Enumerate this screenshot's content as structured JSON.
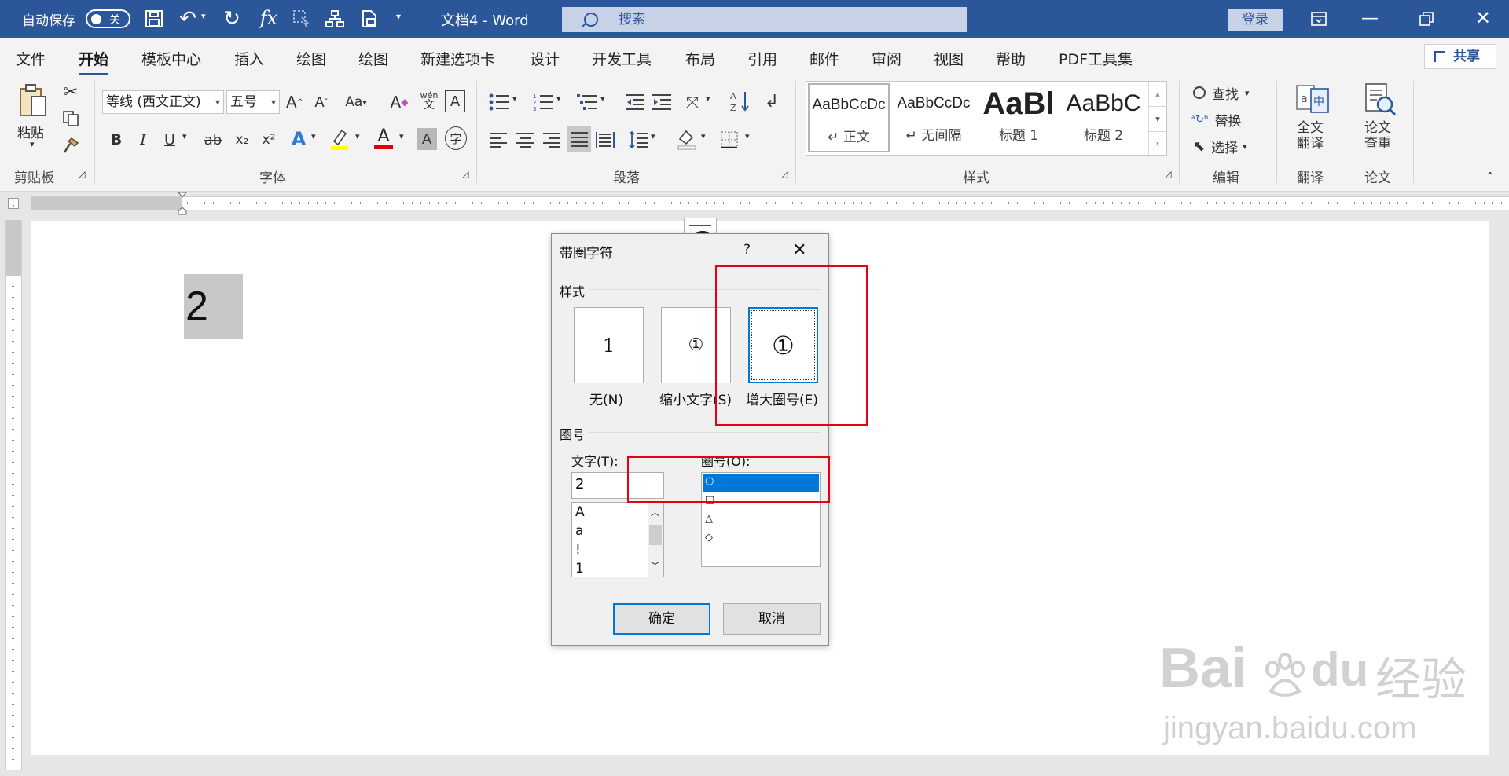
{
  "titlebar": {
    "autosave_label": "自动保存",
    "autosave_state": "关",
    "doc_title": "文档4  -  Word",
    "search_placeholder": "搜索",
    "login": "登录"
  },
  "tabs": [
    "文件",
    "开始",
    "模板中心",
    "插入",
    "绘图",
    "绘图",
    "新建选项卡",
    "设计",
    "开发工具",
    "布局",
    "引用",
    "邮件",
    "审阅",
    "视图",
    "帮助",
    "PDF工具集"
  ],
  "share_label": "共享",
  "ribbon": {
    "clipboard": {
      "paste": "粘贴",
      "group": "剪贴板"
    },
    "font": {
      "font_name": "等线 (西文正文)",
      "font_size": "五号",
      "aa": "Aa",
      "wen": "wén",
      "wen2": "文",
      "group": "字体",
      "bold": "B",
      "italic": "I",
      "underline": "U",
      "strike": "ab",
      "sub": "x₂",
      "sup": "x²",
      "A": "A",
      "frame": "A",
      "circled": "字"
    },
    "paragraph": {
      "group": "段落"
    },
    "styles": {
      "items": [
        {
          "preview": "AaBbCcDc",
          "name": "↵ 正文"
        },
        {
          "preview": "AaBbCcDc",
          "name": "↵ 无间隔"
        },
        {
          "preview": "AaBl",
          "name": "标题 1"
        },
        {
          "preview": "AaBbC",
          "name": "标题 2"
        }
      ],
      "group": "样式"
    },
    "editing": {
      "find": "查找",
      "replace": "替换",
      "select": "选择",
      "group": "编辑"
    },
    "translate": {
      "full": "全文",
      "full2": "翻译",
      "group": "翻译"
    },
    "paper": {
      "check": "论文",
      "check2": "查重",
      "group": "论文"
    }
  },
  "document": {
    "selected_text": "2"
  },
  "dialog": {
    "title": "带圈字符",
    "help": "?",
    "style_section": "样式",
    "styles": [
      {
        "glyph": "1",
        "label": "无(N)"
      },
      {
        "glyph": "①",
        "label": "缩小文字(S)"
      },
      {
        "glyph": "①",
        "label": "增大圈号(E)"
      }
    ],
    "enclosure_section": "圈号",
    "text_label": "文字(T):",
    "text_value": "2",
    "text_list": [
      "A",
      "a",
      "!",
      "1"
    ],
    "enclosure_label": "圈号(O):",
    "enclosure_list": [
      "○",
      "□",
      "△",
      "◇"
    ],
    "ok": "确定",
    "cancel": "取消"
  },
  "watermark": {
    "brand": "Bai",
    "brand2": "du",
    "cn": "经验",
    "url": "jingyan.baidu.com"
  }
}
